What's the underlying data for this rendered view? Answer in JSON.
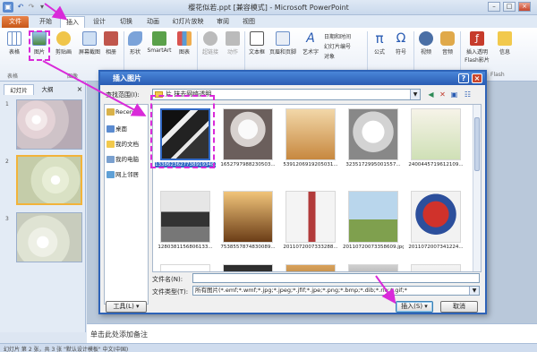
{
  "window": {
    "title": "樱花似若.ppt [兼容模式] - Microsoft PowerPoint",
    "qat_icons": [
      "save-icon",
      "undo-icon",
      "redo-icon",
      "customize-icon"
    ],
    "controls": [
      "–",
      "□",
      "×"
    ]
  },
  "ribbon_tabs": [
    "文件",
    "开始",
    "插入",
    "设计",
    "切换",
    "动画",
    "幻灯片放映",
    "审阅",
    "视图"
  ],
  "ribbon": {
    "buttons": [
      "表格",
      "图片",
      "剪贴画",
      "屏幕截图",
      "相册",
      "形状",
      "SmartArt",
      "图表",
      "超链接",
      "动作",
      "文本框",
      "页眉和页脚",
      "艺术字",
      "公式",
      "符号",
      "视频",
      "音频",
      "插入透明\nFlash影片",
      "信息"
    ],
    "small": [
      "日期和时间",
      "幻灯片编号",
      "对象"
    ],
    "groups": [
      "表格",
      "图像",
      "Flash"
    ]
  },
  "left_panel": {
    "tabs": [
      "幻灯片",
      "大纲"
    ],
    "slide_numbers": [
      "1",
      "2",
      "3"
    ]
  },
  "notes_placeholder": "单击此处添加备注",
  "status": "幻灯片 第 2 张，共 3 张    \"默认设计模板\"    中文(中国)",
  "dialog": {
    "title": "插入图片",
    "look_in_label": "查找范围(I):",
    "look_in_value": "片 抹去网络透明",
    "places": [
      "Recent",
      "桌面",
      "我的文档",
      "我的电脑",
      "网上邻居"
    ],
    "files": [
      "133862362773891934814.jpg",
      "1652797988230503...",
      "5391206919205031...",
      "3235172995001557...",
      "2400445719612109...",
      "1280381156806133...",
      "7538557874830089...",
      "2011072007333288...",
      "20110720073358609.jpg",
      "2011072007341224...",
      "",
      "",
      "",
      "",
      ""
    ],
    "filename_label": "文件名(N):",
    "filename_value": "",
    "filetype_label": "文件类型(T):",
    "filetype_value": "所有图片(*.emf;*.wmf;*.jpg;*.jpeg;*.jfif;*.jpe;*.png;*.bmp;*.dib;*.rle;*.gif;*",
    "tools_label": "工具(L)",
    "insert_label": "插入(S)",
    "cancel_label": "取消"
  },
  "colors": {
    "annotation": "#d92ad9",
    "dialog_title": "#2a5cb3",
    "file_tab": "#c75818"
  }
}
